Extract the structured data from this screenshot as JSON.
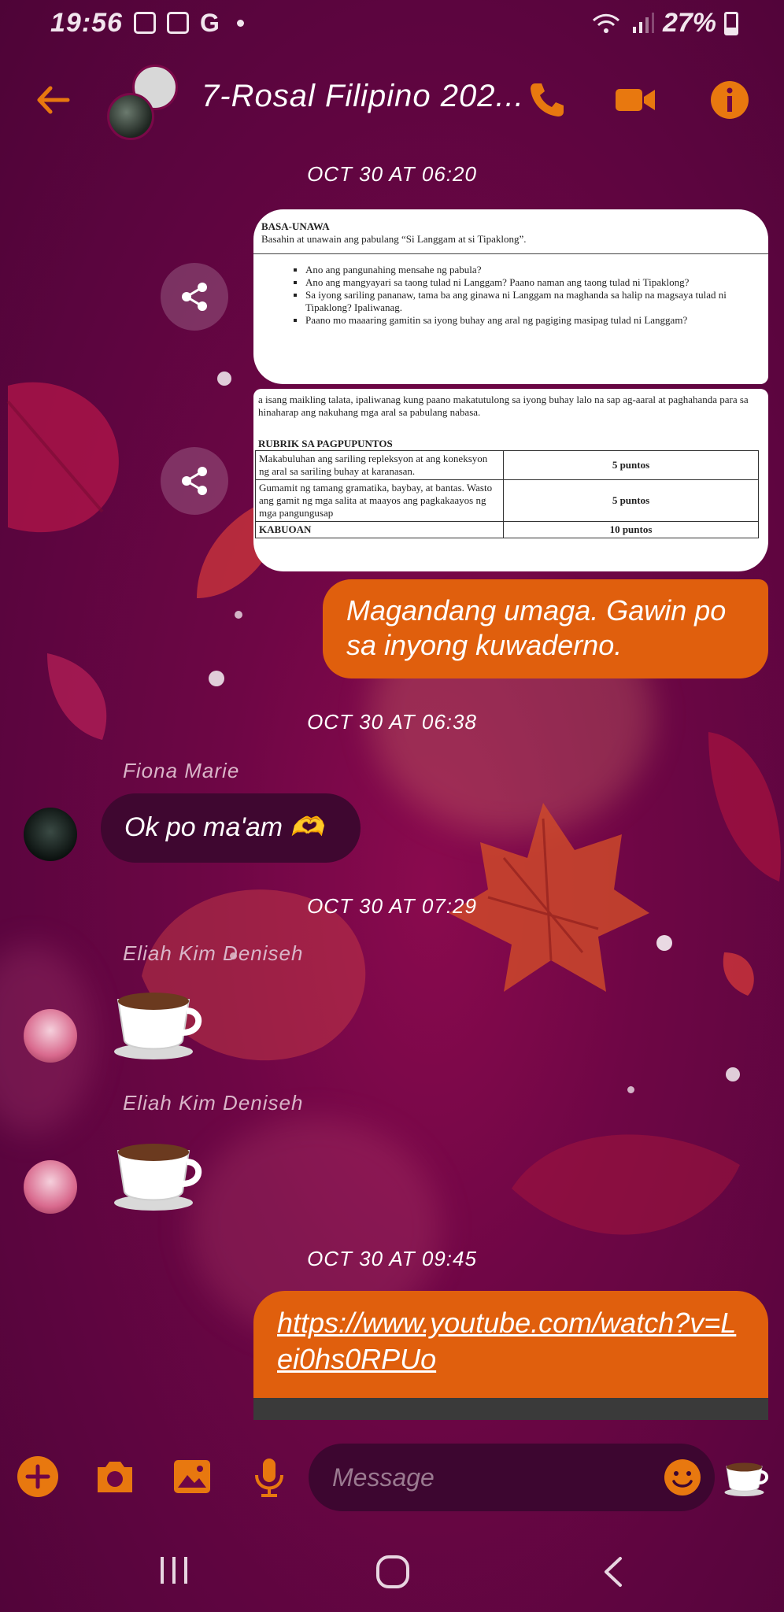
{
  "status_bar": {
    "time": "19:56",
    "notification_icons": [
      "gallery-icon",
      "shopee-icon",
      "google-icon",
      "dot-icon"
    ],
    "google_letter": "G",
    "battery": "27%"
  },
  "header": {
    "title": "7-Rosal Filipino 202...",
    "actions": [
      "phone-icon",
      "video-call-icon",
      "info-icon"
    ]
  },
  "messages": {
    "stamp1": "OCT 30 AT 06:20",
    "doc1": {
      "heading": "BASA-UNAWA",
      "intro": "Basahin at unawain ang pabulang “Si Langgam at si Tipaklong”.",
      "questions": [
        "Ano ang pangunahing mensahe ng pabula?",
        "Ano ang mangyayari sa taong tulad ni Langgam? Paano naman ang taong tulad ni Tipaklong?",
        "Sa iyong sariling pananaw, tama ba ang ginawa ni Langgam na maghanda sa halip na magsaya tulad ni Tipaklong? Ipaliwanag.",
        "Paano mo maaaring gamitin sa iyong buhay ang aral ng pagiging masipag tulad ni Langgam?"
      ]
    },
    "doc2": {
      "intro": "a isang maikling talata, ipaliwanag kung paano makatutulong sa iyong buhay lalo na sap ag-aaral at paghahanda para sa hinaharap ang nakuhang mga aral sa pabulang nabasa.",
      "heading": "RUBRIK SA PAGPUPUNTOS",
      "rows": [
        {
          "criteria": "Makabuluhan ang sariling repleksyon at ang koneksyon ng aral sa sariling buhay at karanasan.",
          "points": "5 puntos"
        },
        {
          "criteria": "Gumamit ng tamang gramatika, baybay, at bantas. Wasto ang gamit ng mga salita at maayos ang pagkakaayos ng mga pangungusap",
          "points": "5 puntos"
        },
        {
          "criteria": "KABUOAN",
          "points": "10 puntos"
        }
      ]
    },
    "text1": "Magandang umaga. Gawin po sa inyong kuwaderno.",
    "stamp2": "OCT 30 AT 06:38",
    "sender1": "Fiona Marie",
    "reply1": "Ok po ma'am 🫶",
    "stamp3": "OCT 30 AT 07:29",
    "sender2": "Eliah Kim Deniseh",
    "sender3": "Eliah Kim Deniseh",
    "emoji_msg": "coffee-cup-emoji",
    "stamp4": "OCT 30 AT 09:45",
    "link": "https://www.youtube.com/watch?v=Lei0hs0RPUo"
  },
  "composer": {
    "placeholder": "Message",
    "buttons": [
      "add-icon",
      "camera-icon",
      "gallery-icon",
      "microphone-icon",
      "emoji-icon",
      "coffee-cup-quick-reaction"
    ]
  },
  "nav": [
    "recents-icon",
    "home-icon",
    "back-icon"
  ],
  "colors": {
    "accent": "#e05f0d",
    "background": "#6e0645",
    "incoming_bubble": "#3f0730"
  }
}
